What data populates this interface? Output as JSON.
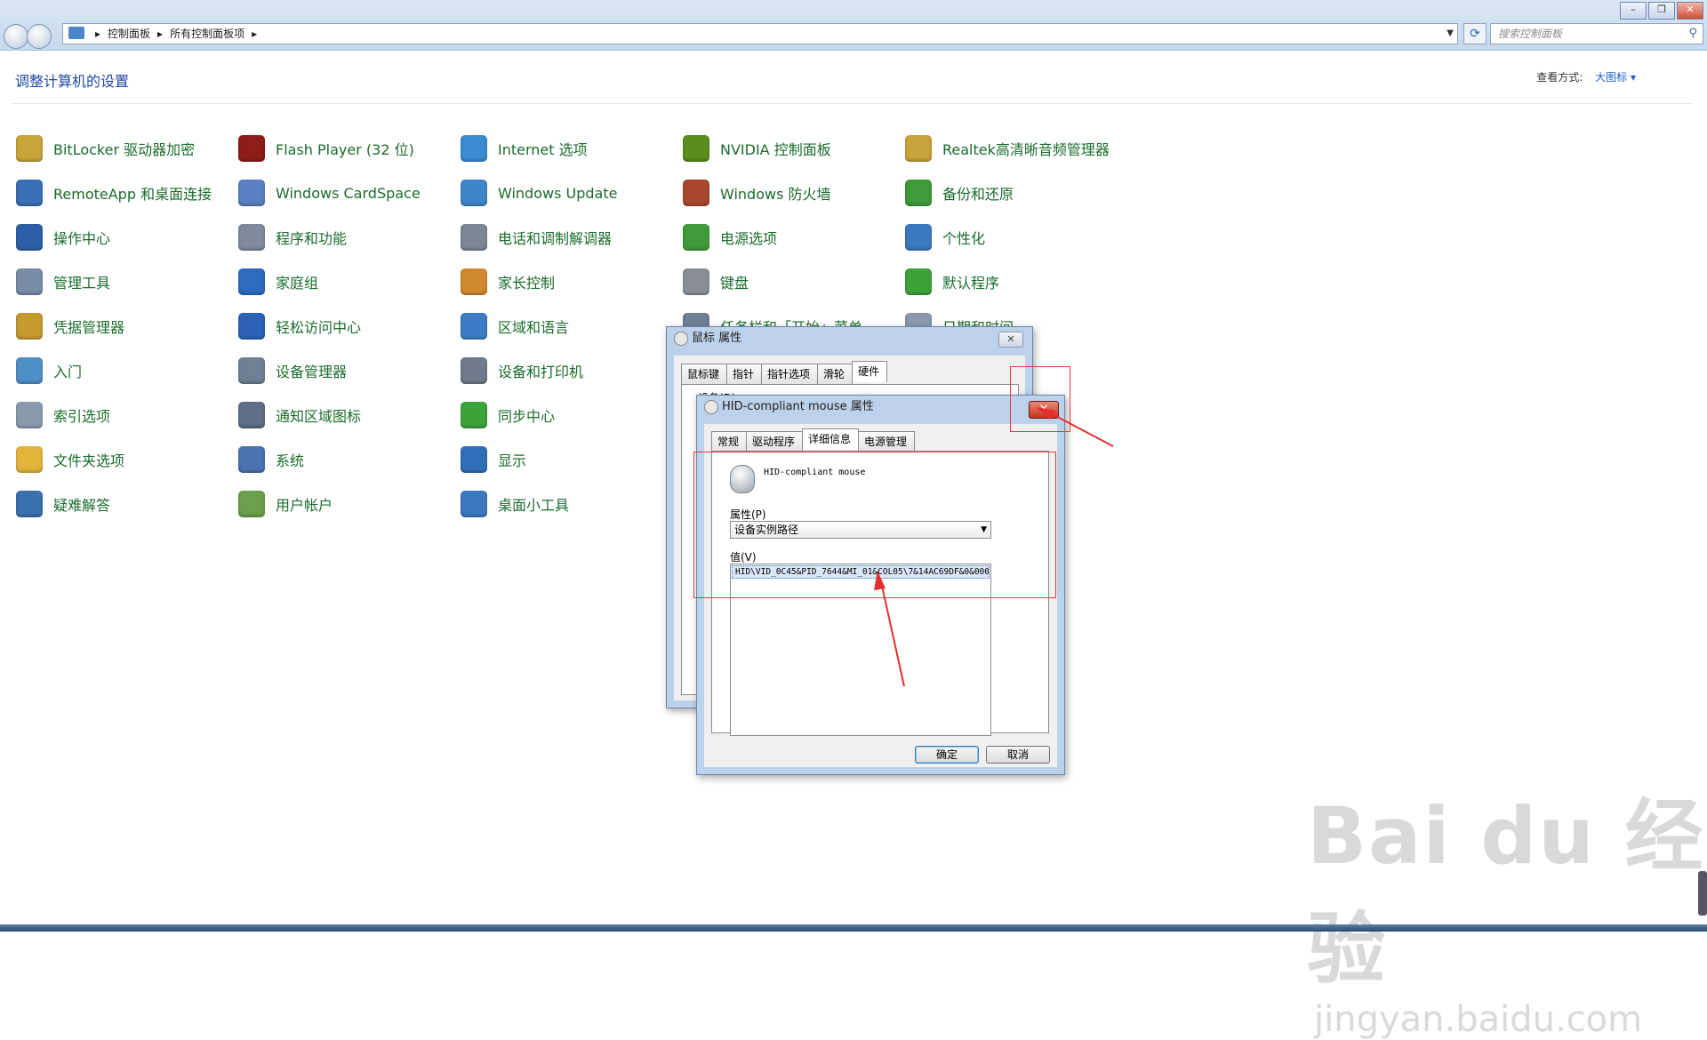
{
  "breadcrumb": [
    "控制面板",
    "所有控制面板项"
  ],
  "search": {
    "placeholder": "搜索控制面板"
  },
  "header": {
    "title": "调整计算机的设置",
    "viewby_label": "查看方式:",
    "viewby_value": "大图标 ▾"
  },
  "columns": [
    [
      {
        "label": "BitLocker 驱动器加密",
        "icon": "bitlocker-icon",
        "color": "#c9a43a"
      },
      {
        "label": "RemoteApp 和桌面连接",
        "icon": "remote-desktop-icon",
        "color": "#3b6fb6"
      },
      {
        "label": "操作中心",
        "icon": "action-center-flag-icon",
        "color": "#2c5fa8"
      },
      {
        "label": "管理工具",
        "icon": "admin-tools-icon",
        "color": "#7a8da6"
      },
      {
        "label": "凭据管理器",
        "icon": "credential-manager-icon",
        "color": "#c59a2f"
      },
      {
        "label": "入门",
        "icon": "getting-started-icon",
        "color": "#4f8fc8"
      },
      {
        "label": "索引选项",
        "icon": "indexing-icon",
        "color": "#8a9aae"
      },
      {
        "label": "文件夹选项",
        "icon": "folder-options-icon",
        "color": "#e3b43b"
      },
      {
        "label": "疑难解答",
        "icon": "troubleshooting-icon",
        "color": "#3a6fb0"
      }
    ],
    [
      {
        "label": "Flash Player (32 位)",
        "icon": "flash-player-icon",
        "color": "#8c1d18"
      },
      {
        "label": "Windows CardSpace",
        "icon": "cardspace-icon",
        "color": "#5a7fc2"
      },
      {
        "label": "程序和功能",
        "icon": "programs-features-icon",
        "color": "#7d8aa0"
      },
      {
        "label": "家庭组",
        "icon": "homegroup-icon",
        "color": "#2e6bc0"
      },
      {
        "label": "轻松访问中心",
        "icon": "ease-of-access-icon",
        "color": "#2b62b8"
      },
      {
        "label": "设备管理器",
        "icon": "device-manager-icon",
        "color": "#6f7f94"
      },
      {
        "label": "通知区域图标",
        "icon": "notification-area-icon",
        "color": "#5d6e86"
      },
      {
        "label": "系统",
        "icon": "system-icon",
        "color": "#4b74b0"
      },
      {
        "label": "用户帐户",
        "icon": "user-accounts-icon",
        "color": "#6aa04a"
      }
    ],
    [
      {
        "label": "Internet 选项",
        "icon": "internet-options-icon",
        "color": "#3a8bd0"
      },
      {
        "label": "Windows Update",
        "icon": "windows-update-icon",
        "color": "#3f86c8"
      },
      {
        "label": "电话和调制解调器",
        "icon": "phone-modem-icon",
        "color": "#7c8796"
      },
      {
        "label": "家长控制",
        "icon": "parental-controls-icon",
        "color": "#d18a2e"
      },
      {
        "label": "区域和语言",
        "icon": "region-language-icon",
        "color": "#3b7cc4"
      },
      {
        "label": "设备和打印机",
        "icon": "devices-printers-icon",
        "color": "#6f7b8c"
      },
      {
        "label": "同步中心",
        "icon": "sync-center-icon",
        "color": "#3ea23a"
      },
      {
        "label": "显示",
        "icon": "display-icon",
        "color": "#2f6fb8"
      },
      {
        "label": "桌面小工具",
        "icon": "gadgets-icon",
        "color": "#3b78c0"
      }
    ],
    [
      {
        "label": "NVIDIA 控制面板",
        "icon": "nvidia-icon",
        "color": "#5a8d1e"
      },
      {
        "label": "Windows 防火墙",
        "icon": "firewall-icon",
        "color": "#a8472e"
      },
      {
        "label": "电源选项",
        "icon": "power-options-icon",
        "color": "#3f9a3a"
      },
      {
        "label": "键盘",
        "icon": "keyboard-icon",
        "color": "#8a8f96"
      },
      {
        "label": "任务栏和「开始」菜单",
        "icon": "taskbar-start-icon",
        "color": "#6f7f94"
      }
    ],
    [
      {
        "label": "Realtek高清晰音频管理器",
        "icon": "realtek-audio-icon",
        "color": "#c8a23a"
      },
      {
        "label": "备份和还原",
        "icon": "backup-restore-icon",
        "color": "#3f9a3a"
      },
      {
        "label": "个性化",
        "icon": "personalization-icon",
        "color": "#3a78c0"
      },
      {
        "label": "默认程序",
        "icon": "default-programs-icon",
        "color": "#3ea23a"
      },
      {
        "label": "日期和时间",
        "icon": "date-time-icon",
        "color": "#8a99ad"
      }
    ]
  ],
  "mouse_dialog": {
    "title": "鼠标 属性",
    "tabs": [
      "鼠标键",
      "指针",
      "指针选项",
      "滑轮",
      "硬件"
    ],
    "active_tab": "硬件",
    "device_label": "设备(D):"
  },
  "hid_dialog": {
    "title": "HID-compliant mouse 属性",
    "tabs": [
      "常规",
      "驱动程序",
      "详细信息",
      "电源管理"
    ],
    "active_tab": "详细信息",
    "device_name": "HID-compliant mouse",
    "property_label": "属性(P)",
    "property_value": "设备实例路径",
    "value_label": "值(V)",
    "value_text": "HID\\VID_0C45&PID_7644&MI_01&COL05\\7&14AC69DF&0&0004",
    "ok_label": "确定",
    "cancel_label": "取消"
  },
  "watermark": {
    "brand": "Bai du 经验",
    "url": "jingyan.baidu.com"
  },
  "window_controls": [
    "–",
    "❐",
    "✕"
  ]
}
